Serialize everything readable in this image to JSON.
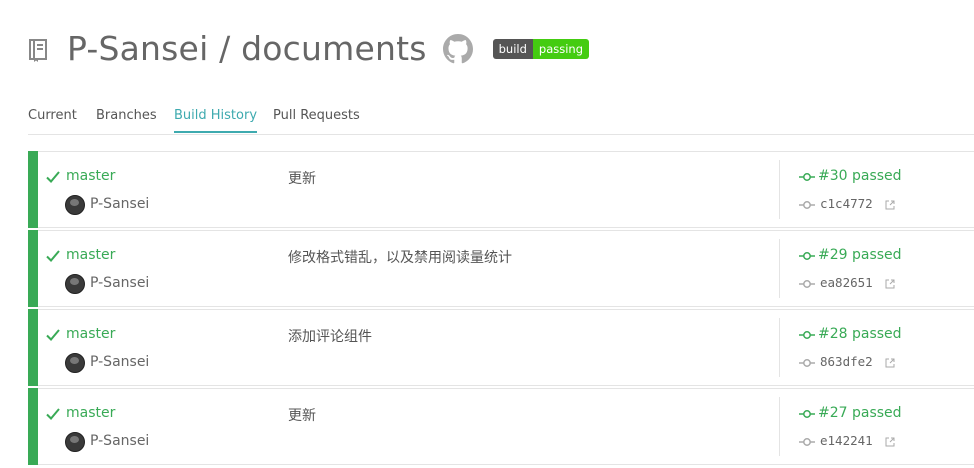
{
  "repo": {
    "title": "P-Sansei / documents",
    "icons": {
      "repo": "repo-book-icon",
      "github": "github-icon"
    },
    "badge": {
      "label": "build",
      "status": "passing",
      "label_color": "#555555",
      "status_color": "#44cc11"
    }
  },
  "tabs": [
    {
      "label": "Current",
      "active": false
    },
    {
      "label": "Branches",
      "active": false
    },
    {
      "label": "Build History",
      "active": true
    },
    {
      "label": "Pull Requests",
      "active": false
    }
  ],
  "builds": [
    {
      "branch": "master",
      "author": "P-Sansei",
      "message": "更新",
      "build": "#30 passed",
      "commit": "c1c4772",
      "status": "passed"
    },
    {
      "branch": "master",
      "author": "P-Sansei",
      "message": "修改格式错乱，以及禁用阅读量统计",
      "build": "#29 passed",
      "commit": "ea82651",
      "status": "passed"
    },
    {
      "branch": "master",
      "author": "P-Sansei",
      "message": "添加评论组件",
      "build": "#28 passed",
      "commit": "863dfe2",
      "status": "passed"
    },
    {
      "branch": "master",
      "author": "P-Sansei",
      "message": "更新",
      "build": "#27 passed",
      "commit": "e142241",
      "status": "passed"
    }
  ],
  "colors": {
    "passed": "#39aa56",
    "active_tab": "#3eaaaf"
  }
}
